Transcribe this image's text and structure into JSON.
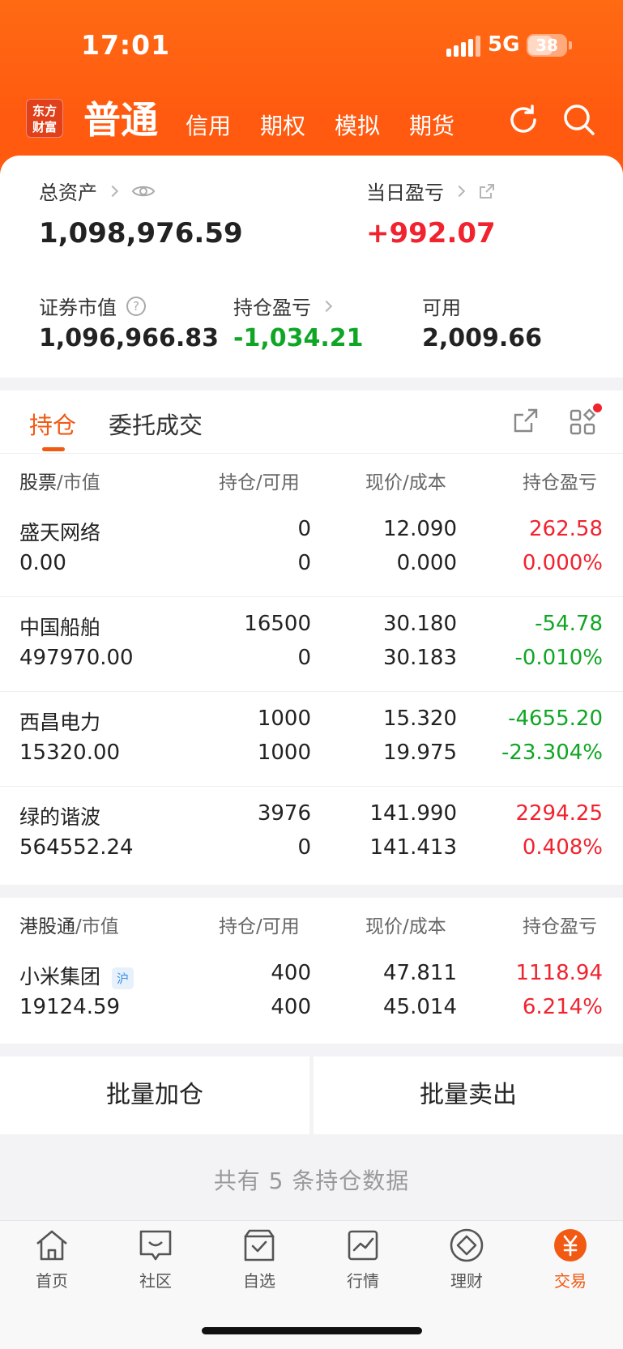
{
  "status": {
    "time": "17:01",
    "network": "5G",
    "battery": "38"
  },
  "header": {
    "logo": "东方财富",
    "tabs": [
      {
        "label": "普通",
        "active": true
      },
      {
        "label": "信用",
        "active": false
      },
      {
        "label": "期权",
        "active": false
      },
      {
        "label": "模拟",
        "active": false
      },
      {
        "label": "期货",
        "active": false
      }
    ],
    "icons": [
      "refresh-icon",
      "search-icon"
    ]
  },
  "summary": {
    "total_assets_label": "总资产",
    "total_assets": "1,098,976.59",
    "daily_pnl_label": "当日盈亏",
    "daily_pnl": "+992.07",
    "market_value_label": "证券市值",
    "market_value": "1,096,966.83",
    "position_pnl_label": "持仓盈亏",
    "position_pnl": "-1,034.21",
    "available_label": "可用",
    "available": "2,009.66"
  },
  "positions_tabs": [
    {
      "label": "持仓",
      "active": true
    },
    {
      "label": "委托成交",
      "active": false
    }
  ],
  "columns": {
    "stock": "股票",
    "sep1": "/",
    "market_value": "市值",
    "holding": "持仓",
    "sep2": "/",
    "available": "可用",
    "price": "现价",
    "sep3": "/",
    "cost": "成本",
    "pnl": "持仓盈亏"
  },
  "stocks": [
    {
      "name": "盛天网络",
      "mv": "0.00",
      "hold": "0",
      "avail": "0",
      "price": "12.090",
      "cost": "0.000",
      "pnl": "262.58",
      "pnl_pct": "0.000%",
      "dir": "up"
    },
    {
      "name": "中国船舶",
      "mv": "497970.00",
      "hold": "16500",
      "avail": "0",
      "price": "30.180",
      "cost": "30.183",
      "pnl": "-54.78",
      "pnl_pct": "-0.010%",
      "dir": "down"
    },
    {
      "name": "西昌电力",
      "mv": "15320.00",
      "hold": "1000",
      "avail": "1000",
      "price": "15.320",
      "cost": "19.975",
      "pnl": "-4655.20",
      "pnl_pct": "-23.304%",
      "dir": "down"
    },
    {
      "name": "绿的谐波",
      "mv": "564552.24",
      "hold": "3976",
      "avail": "0",
      "price": "141.990",
      "cost": "141.413",
      "pnl": "2294.25",
      "pnl_pct": "0.408%",
      "dir": "up"
    }
  ],
  "hk_columns": {
    "stock": "港股通",
    "sep1": "/",
    "market_value": "市值",
    "holding": "持仓",
    "sep2": "/",
    "available": "可用",
    "price": "现价",
    "sep3": "/",
    "cost": "成本",
    "pnl": "持仓盈亏"
  },
  "hk_stocks": [
    {
      "name": "小米集团",
      "badge": "沪",
      "mv": "19124.59",
      "hold": "400",
      "avail": "400",
      "price": "47.811",
      "cost": "45.014",
      "pnl": "1118.94",
      "pnl_pct": "6.214%",
      "dir": "up"
    }
  ],
  "actions": {
    "add": "批量加仓",
    "sell": "批量卖出"
  },
  "count_text": "共有 5 条持仓数据",
  "tabbar": [
    {
      "label": "首页",
      "icon": "home-icon",
      "active": false
    },
    {
      "label": "社区",
      "icon": "chat-icon",
      "active": false
    },
    {
      "label": "自选",
      "icon": "watchlist-icon",
      "active": false
    },
    {
      "label": "行情",
      "icon": "chart-icon",
      "active": false
    },
    {
      "label": "理财",
      "icon": "diamond-icon",
      "active": false
    },
    {
      "label": "交易",
      "icon": "yuan-icon",
      "active": true
    }
  ],
  "colors": {
    "brand": "#ff5a10",
    "up": "#f0232f",
    "down": "#10a625",
    "accent": "#f25a14"
  }
}
